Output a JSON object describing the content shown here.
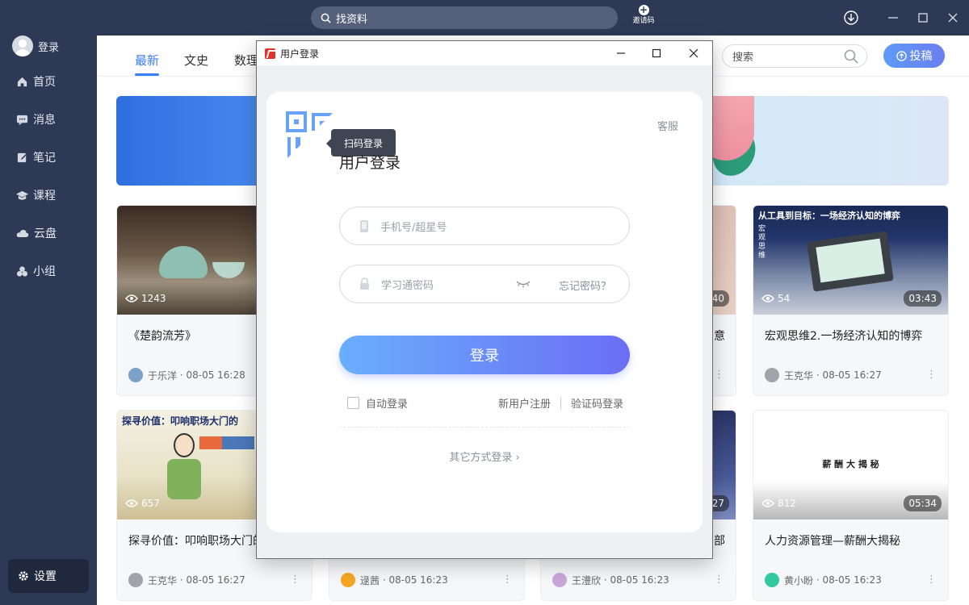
{
  "topbar": {
    "search_text": "找资料",
    "invite_label": "邀请码"
  },
  "sidebar": {
    "login_label": "登录",
    "items": [
      {
        "label": "首页",
        "icon": "home-icon"
      },
      {
        "label": "消息",
        "icon": "message-icon"
      },
      {
        "label": "笔记",
        "icon": "note-icon"
      },
      {
        "label": "课程",
        "icon": "course-icon"
      },
      {
        "label": "云盘",
        "icon": "cloud-icon"
      },
      {
        "label": "小组",
        "icon": "group-icon"
      }
    ],
    "settings_label": "设置"
  },
  "main": {
    "tabs": [
      {
        "label": "最新"
      },
      {
        "label": "文史"
      },
      {
        "label": "数理"
      }
    ],
    "search_placeholder": "搜索",
    "contribute_label": "投稿"
  },
  "cards": [
    {
      "title": "《楚韵流芳》",
      "views": "1243",
      "duration": "",
      "author": "于乐洋",
      "time": "08-05 16:28",
      "avatar_color": "#7da2c9"
    },
    {
      "title": "意",
      "views": "",
      "duration": "40",
      "author": "",
      "time": "",
      "avatar_color": ""
    },
    {
      "title": "宏观思维2.一场经济认知的博弈",
      "views": "54",
      "duration": "03:43",
      "author": "王克华",
      "time": "08-05 16:27",
      "avatar_color": "#a0a4aa"
    },
    {
      "title": "探寻价值：叩响职场大门的问",
      "views": "657",
      "duration": "",
      "author": "王克华",
      "time": "08-05 16:27",
      "avatar_color": "#a0a4aa"
    },
    {
      "title": "",
      "views": "",
      "duration": "",
      "author": "逯茜",
      "time": "08-05 16:23",
      "avatar_color": "#f5a623"
    },
    {
      "title": "部",
      "views": "",
      "duration": "27",
      "author": "王澧欣",
      "time": "08-05 16:23",
      "avatar_color": "#c9a7d9"
    },
    {
      "title": "人力资源管理—薪酬大揭秘",
      "views": "812",
      "duration": "05:34",
      "author": "黄小盼",
      "time": "08-05 16:23",
      "avatar_color": "#33c9a0"
    }
  ],
  "thumb_text": {
    "c3_banner": "从工具到目标：一场经济认知的博弈",
    "c3_side": "宏观思维",
    "c4_banner": "探寻价值：叩响职场大门的",
    "c7_banner": "薪 酬 大 揭 秘"
  },
  "dialog": {
    "title": "用户登录",
    "tooltip": "扫码登录",
    "service": "客服",
    "heading": "用户登录",
    "phone_placeholder": "手机号/超星号",
    "password_placeholder": "学习通密码",
    "forgot": "忘记密码？",
    "login_button": "登录",
    "auto_login": "自动登录",
    "register": "新用户注册",
    "code_login": "验证码登录",
    "other_login": "其它方式登录"
  }
}
